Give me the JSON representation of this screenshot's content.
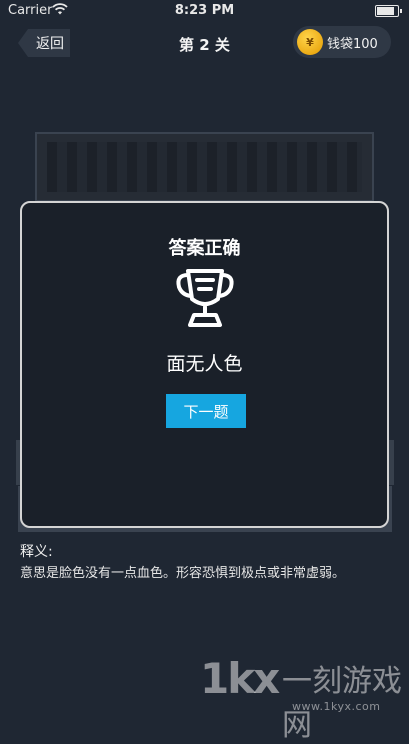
{
  "status_bar": {
    "carrier": "Carrier",
    "time": "8:23 PM"
  },
  "nav": {
    "back_label": "返回",
    "title": "第 2 关",
    "wallet_coin_symbol": "¥",
    "wallet_label": "钱袋100"
  },
  "modal": {
    "title": "答案正确",
    "trophy_icon": "trophy-icon",
    "answer": "面无人色",
    "next_button_label": "下一题"
  },
  "meaning": {
    "label": "释义:",
    "text": "意思是脸色没有一点血色。形容恐惧到极点或非常虚弱。"
  },
  "watermark": {
    "logo": "1kx",
    "name": "一刻游戏网",
    "url": "www.1kyx.com"
  },
  "colors": {
    "background": "#1f2733",
    "accent_button": "#16a6e0",
    "coin": "#f2b01e"
  }
}
